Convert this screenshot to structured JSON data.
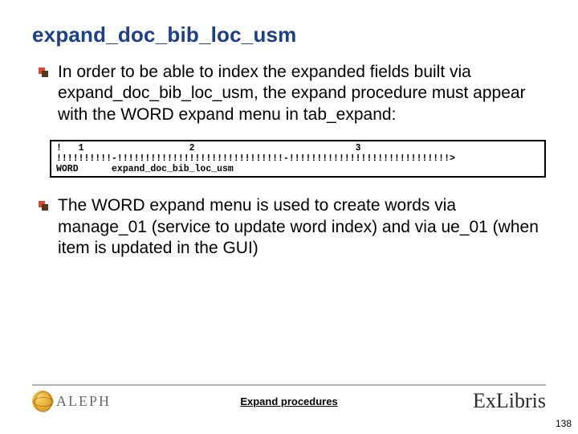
{
  "title": "expand_doc_bib_loc_usm",
  "bullets": [
    "In order to be able to index the expanded fields built via expand_doc_bib_loc_usm, the expand procedure must appear with the WORD expand menu in tab_expand:",
    "The WORD expand menu is used to create words via manage_01 (service to update word index) and via ue_01 (when item is updated in the GUI)"
  ],
  "code": {
    "line1": "!   1                   2                             3",
    "line2": "!!!!!!!!!!-!!!!!!!!!!!!!!!!!!!!!!!!!!!!!!-!!!!!!!!!!!!!!!!!!!!!!!!!!!!!>",
    "line3": "WORD      expand_doc_bib_loc_usm"
  },
  "footer": {
    "left_logo_text": "ALEPH",
    "center_text": "Expand procedures",
    "right_logo_text": "ExLibris",
    "page_number": "138"
  }
}
